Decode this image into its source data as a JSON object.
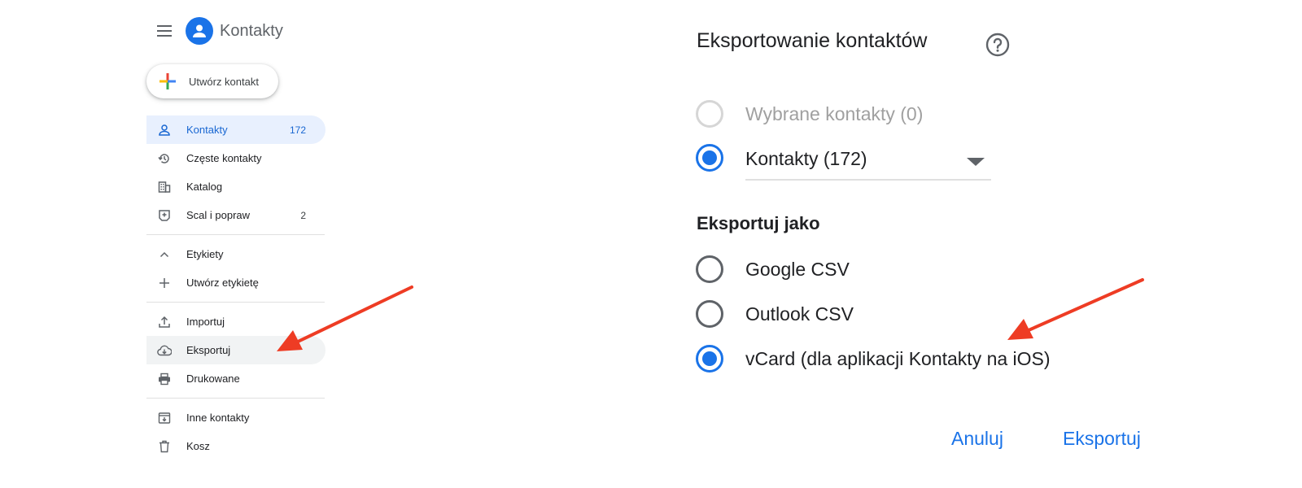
{
  "app": {
    "title": "Kontakty"
  },
  "create_button": {
    "label": "Utwórz kontakt"
  },
  "sidebar": {
    "items": [
      {
        "label": "Kontakty",
        "count": "172",
        "icon": "person-icon"
      },
      {
        "label": "Częste kontakty",
        "count": "",
        "icon": "history-icon"
      },
      {
        "label": "Katalog",
        "count": "",
        "icon": "building-icon"
      },
      {
        "label": "Scal i popraw",
        "count": "2",
        "icon": "merge-icon"
      },
      {
        "label": "Etykiety",
        "count": "",
        "icon": "chevron-up-icon"
      },
      {
        "label": "Utwórz etykietę",
        "count": "",
        "icon": "plus-icon"
      },
      {
        "label": "Importuj",
        "count": "",
        "icon": "upload-icon"
      },
      {
        "label": "Eksportuj",
        "count": "",
        "icon": "cloud-download-icon"
      },
      {
        "label": "Drukowane",
        "count": "",
        "icon": "printer-icon"
      },
      {
        "label": "Inne kontakty",
        "count": "",
        "icon": "archive-icon"
      },
      {
        "label": "Kosz",
        "count": "",
        "icon": "trash-icon"
      }
    ]
  },
  "dialog": {
    "title": "Eksportowanie kontaktów",
    "scope_options": [
      {
        "label": "Wybrane kontakty (0)",
        "state": "disabled"
      },
      {
        "label": "",
        "state": "selected"
      }
    ],
    "contacts_select_value": "Kontakty (172)",
    "export_as_heading": "Eksportuj jako",
    "format_options": [
      {
        "label": "Google CSV",
        "state": "unselected"
      },
      {
        "label": "Outlook CSV",
        "state": "unselected"
      },
      {
        "label": "vCard (dla aplikacji Kontakty na iOS)",
        "state": "selected"
      }
    ],
    "cancel_label": "Anuluj",
    "export_label": "Eksportuj"
  },
  "colors": {
    "accent": "#1a73e8",
    "active_nav_bg": "#e8f0fe",
    "annotation_arrow": "#ee3c24"
  }
}
